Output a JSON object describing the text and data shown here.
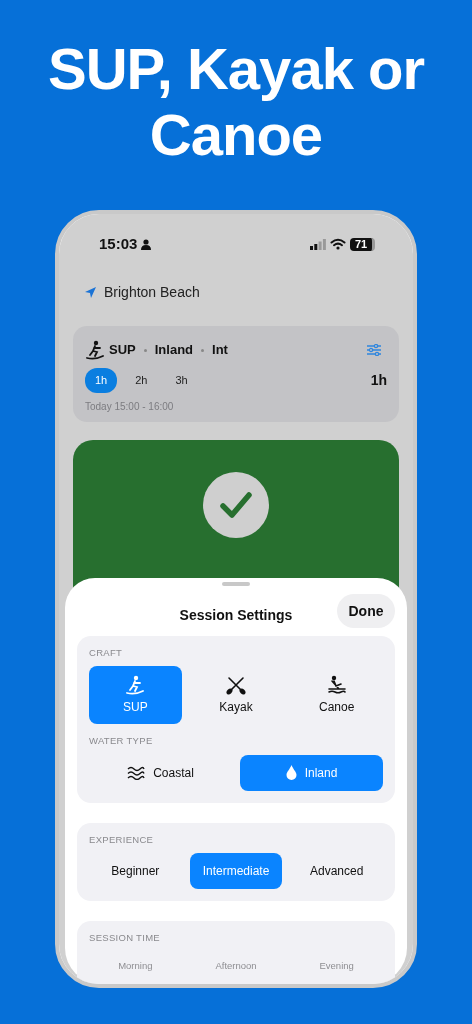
{
  "headline": "SUP, Kayak or Canoe",
  "status_bar": {
    "time": "15:03",
    "battery": "71"
  },
  "location": "Brighton Beach",
  "summary": {
    "craft": "SUP",
    "water": "Inland",
    "level": "Int",
    "durations": [
      {
        "label": "1h",
        "selected": true
      },
      {
        "label": "2h",
        "selected": false
      },
      {
        "label": "3h",
        "selected": false
      }
    ],
    "duration_value": "1h",
    "time_range": "Today 15:00 - 16:00"
  },
  "sheet": {
    "title": "Session Settings",
    "done": "Done",
    "groups": [
      {
        "subsections": [
          {
            "heading": "CRAFT",
            "kind": "tiles",
            "options": [
              {
                "label": "SUP",
                "kind": "sup",
                "selected": true
              },
              {
                "label": "Kayak",
                "kind": "kayak",
                "selected": false
              },
              {
                "label": "Canoe",
                "kind": "canoe",
                "selected": false
              }
            ]
          },
          {
            "heading": "WATER TYPE",
            "kind": "pills",
            "options": [
              {
                "label": "Coastal",
                "kind": "waves",
                "selected": false
              },
              {
                "label": "Inland",
                "kind": "drop",
                "selected": true
              }
            ]
          }
        ]
      },
      {
        "subsections": [
          {
            "heading": "EXPERIENCE",
            "kind": "pills",
            "options": [
              {
                "label": "Beginner",
                "selected": false
              },
              {
                "label": "Intermediate",
                "selected": true
              },
              {
                "label": "Advanced",
                "selected": false
              }
            ]
          }
        ]
      },
      {
        "subsections": [
          {
            "heading": "SESSION TIME",
            "kind": "plain",
            "options": [
              {
                "label": "Morning",
                "selected": false,
                "disabled": true
              },
              {
                "label": "Afternoon",
                "selected": false,
                "disabled": true
              },
              {
                "label": "Evening",
                "selected": false,
                "disabled": true
              }
            ]
          }
        ]
      }
    ]
  }
}
